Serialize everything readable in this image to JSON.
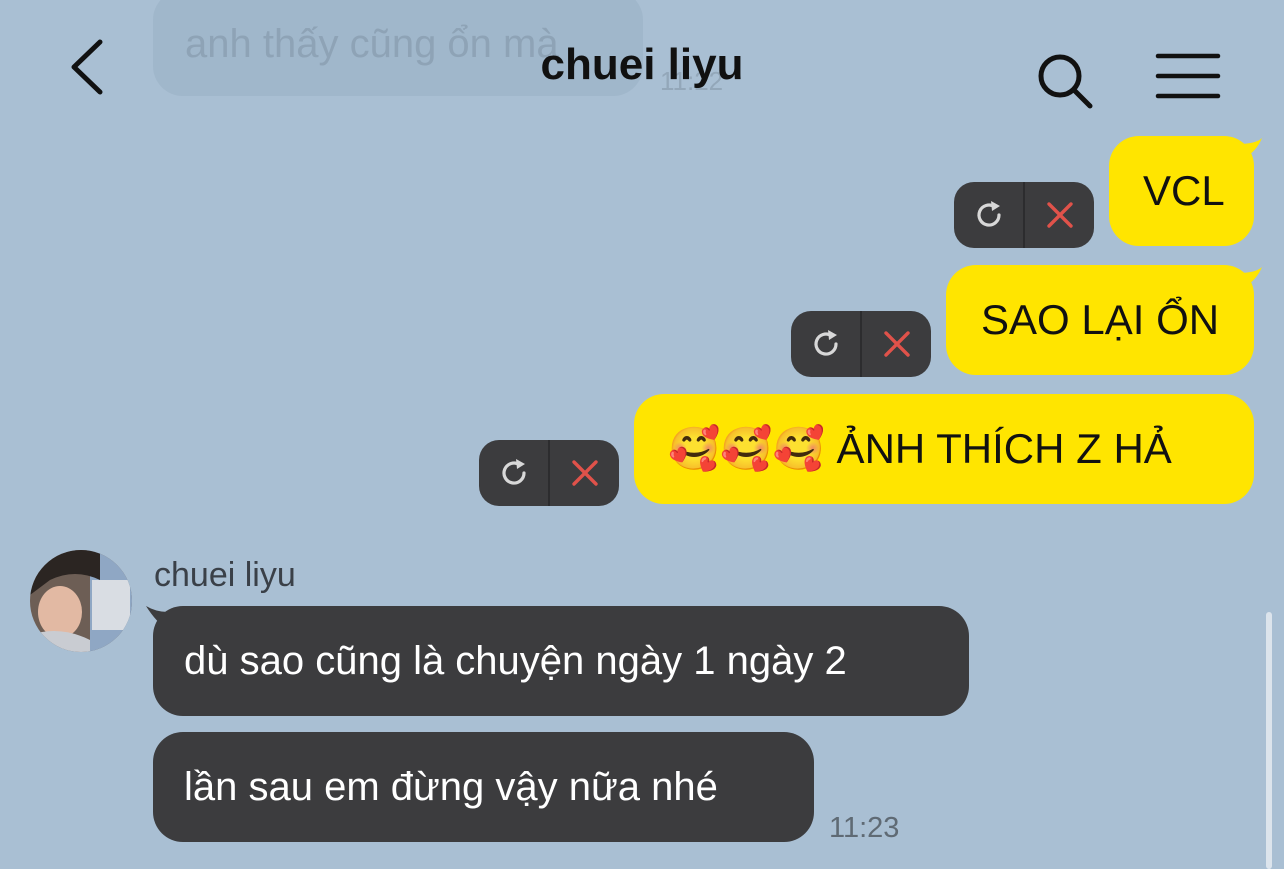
{
  "header": {
    "title": "chuei liyu"
  },
  "previous_message": {
    "text": "anh thấy cũng ổn mà",
    "time": "11:22"
  },
  "outgoing": [
    {
      "text": "VCL",
      "status": "failed"
    },
    {
      "text": "SAO LẠI ỔN",
      "status": "failed"
    },
    {
      "text": "🥰🥰🥰 ẢNH THÍCH Z HẢ",
      "status": "failed"
    }
  ],
  "incoming": {
    "sender": "chuei liyu",
    "messages": [
      {
        "text": "dù sao cũng là chuyện ngày 1 ngày 2"
      },
      {
        "text": "lần sau em đừng vậy nữa nhé"
      }
    ],
    "time": "11:23"
  },
  "colors": {
    "background": "#a9bfd3",
    "outgoing_bubble": "#ffe500",
    "incoming_bubble": "#3c3c3e",
    "delete_icon": "#e0524a"
  },
  "icons": {
    "back": "chevron-left-icon",
    "search": "search-icon",
    "menu": "menu-icon",
    "retry": "retry-icon",
    "delete": "close-icon"
  }
}
